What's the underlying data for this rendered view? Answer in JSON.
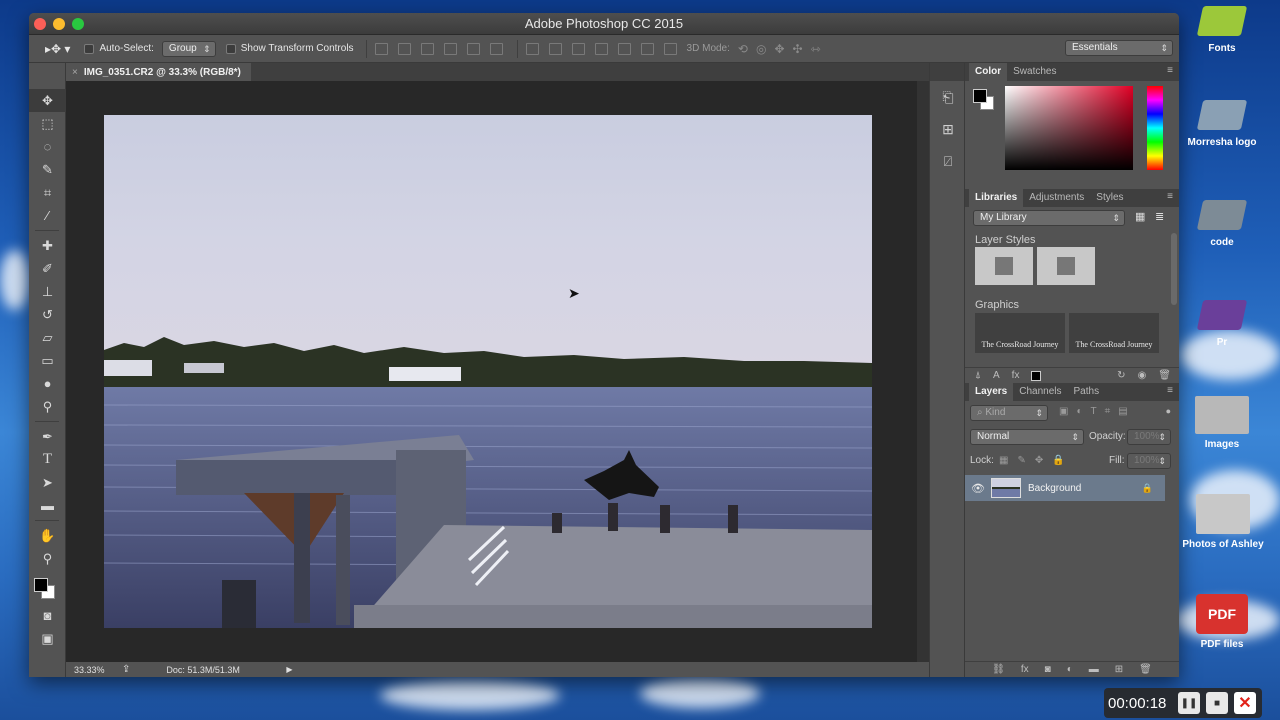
{
  "window": {
    "title": "Adobe Photoshop CC 2015"
  },
  "options_bar": {
    "auto_select_label": "Auto-Select:",
    "auto_select_value": "Group",
    "show_transform_label": "Show Transform Controls",
    "three_d_mode_label": "3D Mode:",
    "workspace_value": "Essentials"
  },
  "document": {
    "tab_close": "×",
    "tab_title": "IMG_0351.CR2 @ 33.3% (RGB/8*)",
    "zoom": "33.33%",
    "doc_size": "Doc: 51.3M/51.3M"
  },
  "color_panel": {
    "tabs": [
      "Color",
      "Swatches"
    ]
  },
  "libraries_panel": {
    "tabs": [
      "Libraries",
      "Adjustments",
      "Styles"
    ],
    "library_select": "My Library",
    "layer_styles_label": "Layer Styles",
    "graphics_label": "Graphics",
    "graphic_text_1": "The CrossRoad Journey",
    "graphic_text_2": "The CrossRoad Journey"
  },
  "layers_panel": {
    "tabs": [
      "Layers",
      "Channels",
      "Paths"
    ],
    "filter_value": "Kind",
    "blend_mode": "Normal",
    "opacity_label": "Opacity:",
    "opacity_value": "100%",
    "lock_label": "Lock:",
    "fill_label": "Fill:",
    "fill_value": "100%",
    "layer_name": "Background"
  },
  "desktop": {
    "icons": [
      {
        "label": "Fonts",
        "color": "#9cc83a"
      },
      {
        "label": "Morresha logo",
        "color": "#8aa0b4"
      },
      {
        "label": "code",
        "color": "#7d8b96"
      },
      {
        "label": "Pr",
        "color": "#6a3f9a"
      },
      {
        "label": "Images",
        "color": "#b8b8b8"
      },
      {
        "label": "Photos of Ashley",
        "color": "#c8c8c8"
      },
      {
        "label": "PDF files",
        "color": "#d8322e"
      }
    ]
  },
  "recorder": {
    "time": "00:00:18"
  },
  "colors": {
    "accent": "#4b90d9",
    "layer_selected": "#6b7a8c"
  }
}
